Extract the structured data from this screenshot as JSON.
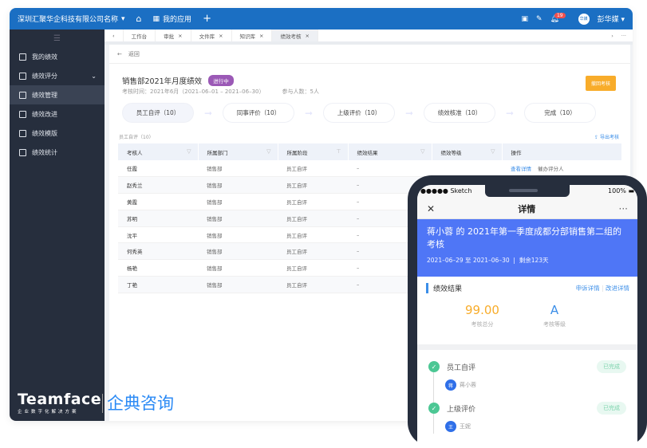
{
  "topbar": {
    "company": "深圳汇聚华企科技有限公司名称",
    "my_apps": "我的应用",
    "notification_count": "19",
    "avatar_text": "华媒",
    "user": "彭华媒"
  },
  "sidebar": {
    "items": [
      {
        "label": "我的绩效"
      },
      {
        "label": "绩效评分"
      },
      {
        "label": "绩效管理",
        "active": true
      },
      {
        "label": "绩效改进"
      },
      {
        "label": "绩效模版"
      },
      {
        "label": "绩效统计"
      }
    ]
  },
  "tabs": [
    {
      "label": "工作台"
    },
    {
      "label": "审批"
    },
    {
      "label": "文件库"
    },
    {
      "label": "知识库"
    },
    {
      "label": "绩效考核",
      "active": true
    }
  ],
  "page": {
    "back": "返回",
    "title": "销售部2021年月度绩效",
    "status": "进行中",
    "period": "考核时间：2021年6月（2021–06–01 – 2021–06–30）",
    "participants": "参与人数：5人",
    "recall_button": "撤回考核",
    "section_label": "员工自评（10）",
    "export": "导出考核"
  },
  "steps": [
    "员工自评（10）",
    "同事评价（10）",
    "上级评价（10）",
    "绩效核准（10）",
    "完成（10）"
  ],
  "table": {
    "headers": [
      "考核人",
      "所属部门",
      "所属阶段",
      "绩效结果",
      "绩效等级",
      "操作"
    ],
    "rows": [
      [
        "任霞",
        "销售部",
        "员工自评",
        "–",
        ""
      ],
      [
        "赵秀兰",
        "销售部",
        "员工自评",
        "–",
        ""
      ],
      [
        "黄霞",
        "销售部",
        "员工自评",
        "–",
        ""
      ],
      [
        "苏明",
        "销售部",
        "员工自评",
        "–",
        ""
      ],
      [
        "沈平",
        "销售部",
        "员工自评",
        "–",
        ""
      ],
      [
        "何秀英",
        "销售部",
        "员工自评",
        "–",
        ""
      ],
      [
        "杨艳",
        "销售部",
        "员工自评",
        "–",
        ""
      ],
      [
        "丁艳",
        "销售部",
        "员工自评",
        "–",
        ""
      ]
    ],
    "actions": [
      "查看详情",
      "催办评分人"
    ]
  },
  "phone": {
    "carrier": "●●●●● Sketch",
    "battery": "100%",
    "title": "详情",
    "headline": "蒋小蓉 的 2021年第一季度成都分部销售第二组的考核",
    "dates": "2021–06–29 至 2021–06–30",
    "remaining": "剩余123天",
    "result_label": "绩效结果",
    "appeal": "申诉详情",
    "improve": "改进详情",
    "score": "99.00",
    "score_caption": "考核总分",
    "grade": "A",
    "grade_caption": "考核等级",
    "flow": [
      {
        "stage": "员工自评",
        "status": "已完成",
        "person_initial": "蒋",
        "person": "蒋小蓉"
      },
      {
        "stage": "上级评价",
        "status": "已完成",
        "person_initial": "王",
        "person": "王妮"
      }
    ]
  },
  "branding": {
    "logo": "Teamface",
    "tagline": "企业数字化解决方案",
    "partner": "企典咨询"
  },
  "colors": {
    "topbar": "#1b6fc3",
    "sidebar": "#262e3d",
    "status": "#9b59b6",
    "recall": "#f8ac2a",
    "band": "#4f76f6",
    "score": "#f8ac2a",
    "grade": "#3b8ee8"
  }
}
